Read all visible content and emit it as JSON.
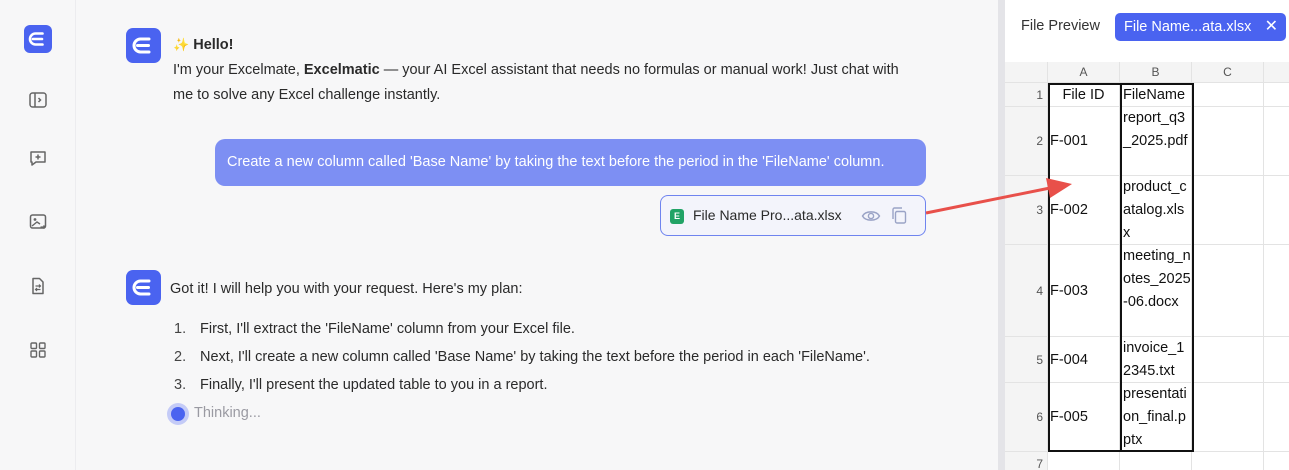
{
  "sidebar": {
    "items": [
      {
        "icon": "logo-icon"
      },
      {
        "icon": "collapse-panel-icon"
      },
      {
        "icon": "new-chat-icon"
      },
      {
        "icon": "image-swap-icon"
      },
      {
        "icon": "file-swap-icon"
      },
      {
        "icon": "layout-grid-icon"
      }
    ]
  },
  "chat": {
    "greeting": {
      "emoji": "✨",
      "hello": "Hello!",
      "intro_pre": "I'm your Excelmate, ",
      "intro_brand": "Excelmatic",
      "intro_line1_post": " — your AI Excel assistant that needs no formulas or manual work! Just chat with",
      "intro_line2": "me to solve any Excel challenge instantly."
    },
    "user_message": "Create a new column called 'Base Name' by taking the text before the period in the 'FileName' column.",
    "attachment": {
      "badge": "E",
      "name": "File Name Pro...ata.xlsx"
    },
    "reply": {
      "intro": "Got it! I will help you with your request. Here's my plan:",
      "steps": [
        {
          "num": "1.",
          "text": "First, I'll extract the 'FileName' column from your Excel file."
        },
        {
          "num": "2.",
          "text": "Next, I'll create a new column called 'Base Name' by taking the text before the period in each 'FileName'."
        },
        {
          "num": "3.",
          "text": "Finally, I'll present the updated table to you in a report."
        }
      ]
    },
    "status": "Thinking..."
  },
  "preview": {
    "title": "File Preview",
    "tab_label": "File Name...ata.xlsx",
    "tab_close": "✕",
    "columns": [
      "A",
      "B",
      "C"
    ],
    "rows": [
      {
        "num": "1",
        "a": "File ID",
        "b": "FileName"
      },
      {
        "num": "2",
        "a": "F-001",
        "b": "report_q3_2025.pdf"
      },
      {
        "num": "3",
        "a": "F-002",
        "b": "product_catalog.xlsx"
      },
      {
        "num": "4",
        "a": "F-003",
        "b": "meeting_notes_2025-06.docx"
      },
      {
        "num": "5",
        "a": "F-004",
        "b": "invoice_12345.txt"
      },
      {
        "num": "6",
        "a": "F-005",
        "b": "presentation_final.pptx"
      },
      {
        "num": "7",
        "a": "",
        "b": ""
      }
    ]
  },
  "colors": {
    "accent": "#4a63f0",
    "user_bubble": "#7d8ff3",
    "annotation_arrow": "#e8504a"
  }
}
